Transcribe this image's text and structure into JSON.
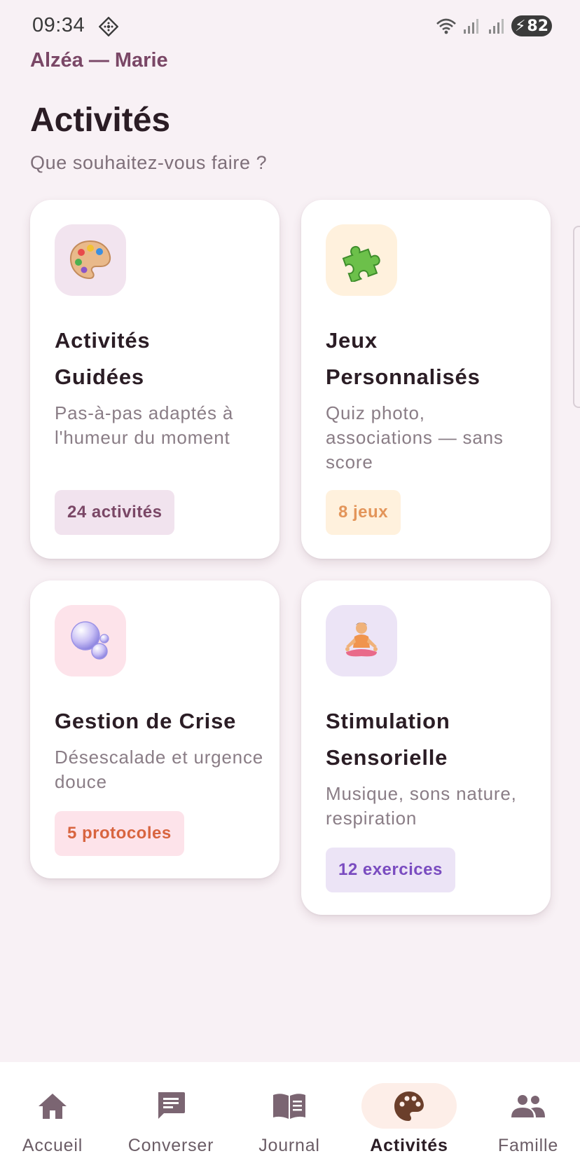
{
  "status_bar": {
    "time": "09:34",
    "battery": "82"
  },
  "app": {
    "brand": "Alzéa — Marie",
    "title": "Activités",
    "subtitle": "Que souhaitez-vous faire ?"
  },
  "cards": [
    {
      "title_line1": "Activités",
      "title_line2": "Guidées",
      "description": "Pas-à-pas adaptés à l'humeur du moment",
      "badge": "24 activités",
      "icon": "palette-icon",
      "icon_bg": "#f2e4ef",
      "badge_bg": "#f1e3ee",
      "badge_color": "#7a4766"
    },
    {
      "title_line1": "Jeux",
      "title_line2": "Personnalisés",
      "description": "Quiz photo, associations — sans score",
      "badge": "8 jeux",
      "icon": "puzzle-icon",
      "icon_bg": "#fff1dd",
      "badge_bg": "#fff1dd",
      "badge_color": "#e3955a"
    },
    {
      "title_line1": "Gestion de Crise",
      "title_line2": "",
      "description": "Désescalade et urgence douce",
      "badge": "5 protocoles",
      "icon": "bubbles-icon",
      "icon_bg": "#fde3ea",
      "badge_bg": "#fde3ea",
      "badge_color": "#d8643f"
    },
    {
      "title_line1": "Stimulation",
      "title_line2": "Sensorielle",
      "description": "Musique, sons nature, respiration",
      "badge": "12 exercices",
      "icon": "meditation-icon",
      "icon_bg": "#ece4f6",
      "badge_bg": "#ece4f6",
      "badge_color": "#7a4cc0"
    }
  ],
  "nav": [
    {
      "label": "Accueil",
      "icon": "home-icon"
    },
    {
      "label": "Converser",
      "icon": "chat-icon"
    },
    {
      "label": "Journal",
      "icon": "book-icon"
    },
    {
      "label": "Activités",
      "icon": "palette-icon",
      "active": true
    },
    {
      "label": "Famille",
      "icon": "people-icon"
    }
  ]
}
